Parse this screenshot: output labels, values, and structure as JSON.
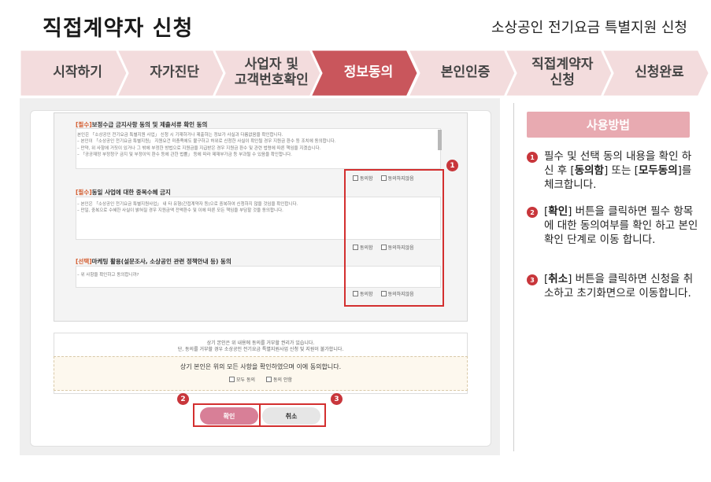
{
  "header": {
    "title": "직접계약자 신청",
    "subtitle": "소상공인 전기요금 특별지원 신청"
  },
  "steps": [
    {
      "label": "시작하기",
      "active": false
    },
    {
      "label": "자가진단",
      "active": false
    },
    {
      "label": "사업자 및\n고객번호확인",
      "active": false
    },
    {
      "label": "정보동의",
      "active": true
    },
    {
      "label": "본인인증",
      "active": false
    },
    {
      "label": "직접계약자\n신청",
      "active": false
    },
    {
      "label": "신청완료",
      "active": false
    }
  ],
  "colors": {
    "step_inactive": "#f3dcdd",
    "step_active": "#c9565c",
    "badge": "#c8363b",
    "highlight_border": "#d32f2f",
    "confirm_button": "#d87f97",
    "howto_bg": "#e8aab1"
  },
  "form": {
    "sections": [
      {
        "tag": "[필수]",
        "title": "보정수급 금지사항 동의 및 제출서류 확인 동의",
        "body": "본인은 「소상공인 전기요금 특별지원 사업」 신청 시 기재하거나 제출하는 정보가 사실과 다름없음을 확인합니다.\n– 본인이 「소상공인 전기요금 특별지원」 지원요건 미충족에도 불구하고 허위로 신청한 사실이 확인될 경우 지원금 환수 등 조치에 동의합니다.\n– 만약, 위 사항에 거짓이 있거나 그 밖에 부정한 방법으로 지원금을 지급받은 경우 지원금 환수 및 관련 법령에 따른 책임을 지겠습니다.\n– 「공공재정 부정청구 금지 및 부정이익 환수 등에 관한 법률」 등에 따라 제재부가금 등 부과될 수 있음을 확인합니다.",
        "agree_label": "동의함",
        "disagree_label": "동의하지않음"
      },
      {
        "tag": "[필수]",
        "title": "동일 사업에 대한 중복수혜 금지",
        "body": "– 본인은 「소상공인 전기요금 특별지원사업」 내 타 유형(간접계약자 등)으로 중복하여 신청하지 않을 것임을 확인합니다.\n– 만일, 중복으로 수혜한 사실이 밝혀질 경우 지원금액 전액환수 및 이에 따른 모든 책임을 부담할 것을 동의합니다.",
        "agree_label": "동의함",
        "disagree_label": "동의하지않음"
      },
      {
        "tag": "[선택]",
        "title": "마케팅 활용(설문조사, 소상공인 관련 정책안내 등) 동의",
        "body": "– 위 사항을 확인하고 동의합니까?",
        "agree_label": "동의함",
        "disagree_label": "동의하지않음"
      }
    ],
    "notice_line1": "상기 본인은 위 내용에 동의를 거부할 권리가 있습니다.",
    "notice_line2": "단, 동의를 거부할 경우 소상공인 전기요금 특별지원사업 신청 및 지원이 불가합니다.",
    "agree_all_title": "상기 본인은 위의 모든 사항을 확인하였으며 이에 동의합니다.",
    "agree_all_label": "모두 동의",
    "agree_all_alt_label": "동의 안함",
    "confirm_label": "확인",
    "cancel_label": "취소"
  },
  "badges": [
    "1",
    "2",
    "3"
  ],
  "howto": {
    "title": "사용방법",
    "items": [
      {
        "num": "1",
        "html": "필수 및 선택 동의 내용을 확인 하신 후 [<b>동의함</b>] 또는 [<b>모두동의</b>]를 체크합니다."
      },
      {
        "num": "2",
        "html": "[<b>확인</b>] 버튼을 클릭하면 필수 항목에 대한 동의여부를 확인 하고 본인 확인 단계로 이동 합니다."
      },
      {
        "num": "3",
        "html": "[<b>취소</b>] 버튼을 클릭하면 신청을 취소하고 초기화면으로 이동합니다."
      }
    ]
  }
}
